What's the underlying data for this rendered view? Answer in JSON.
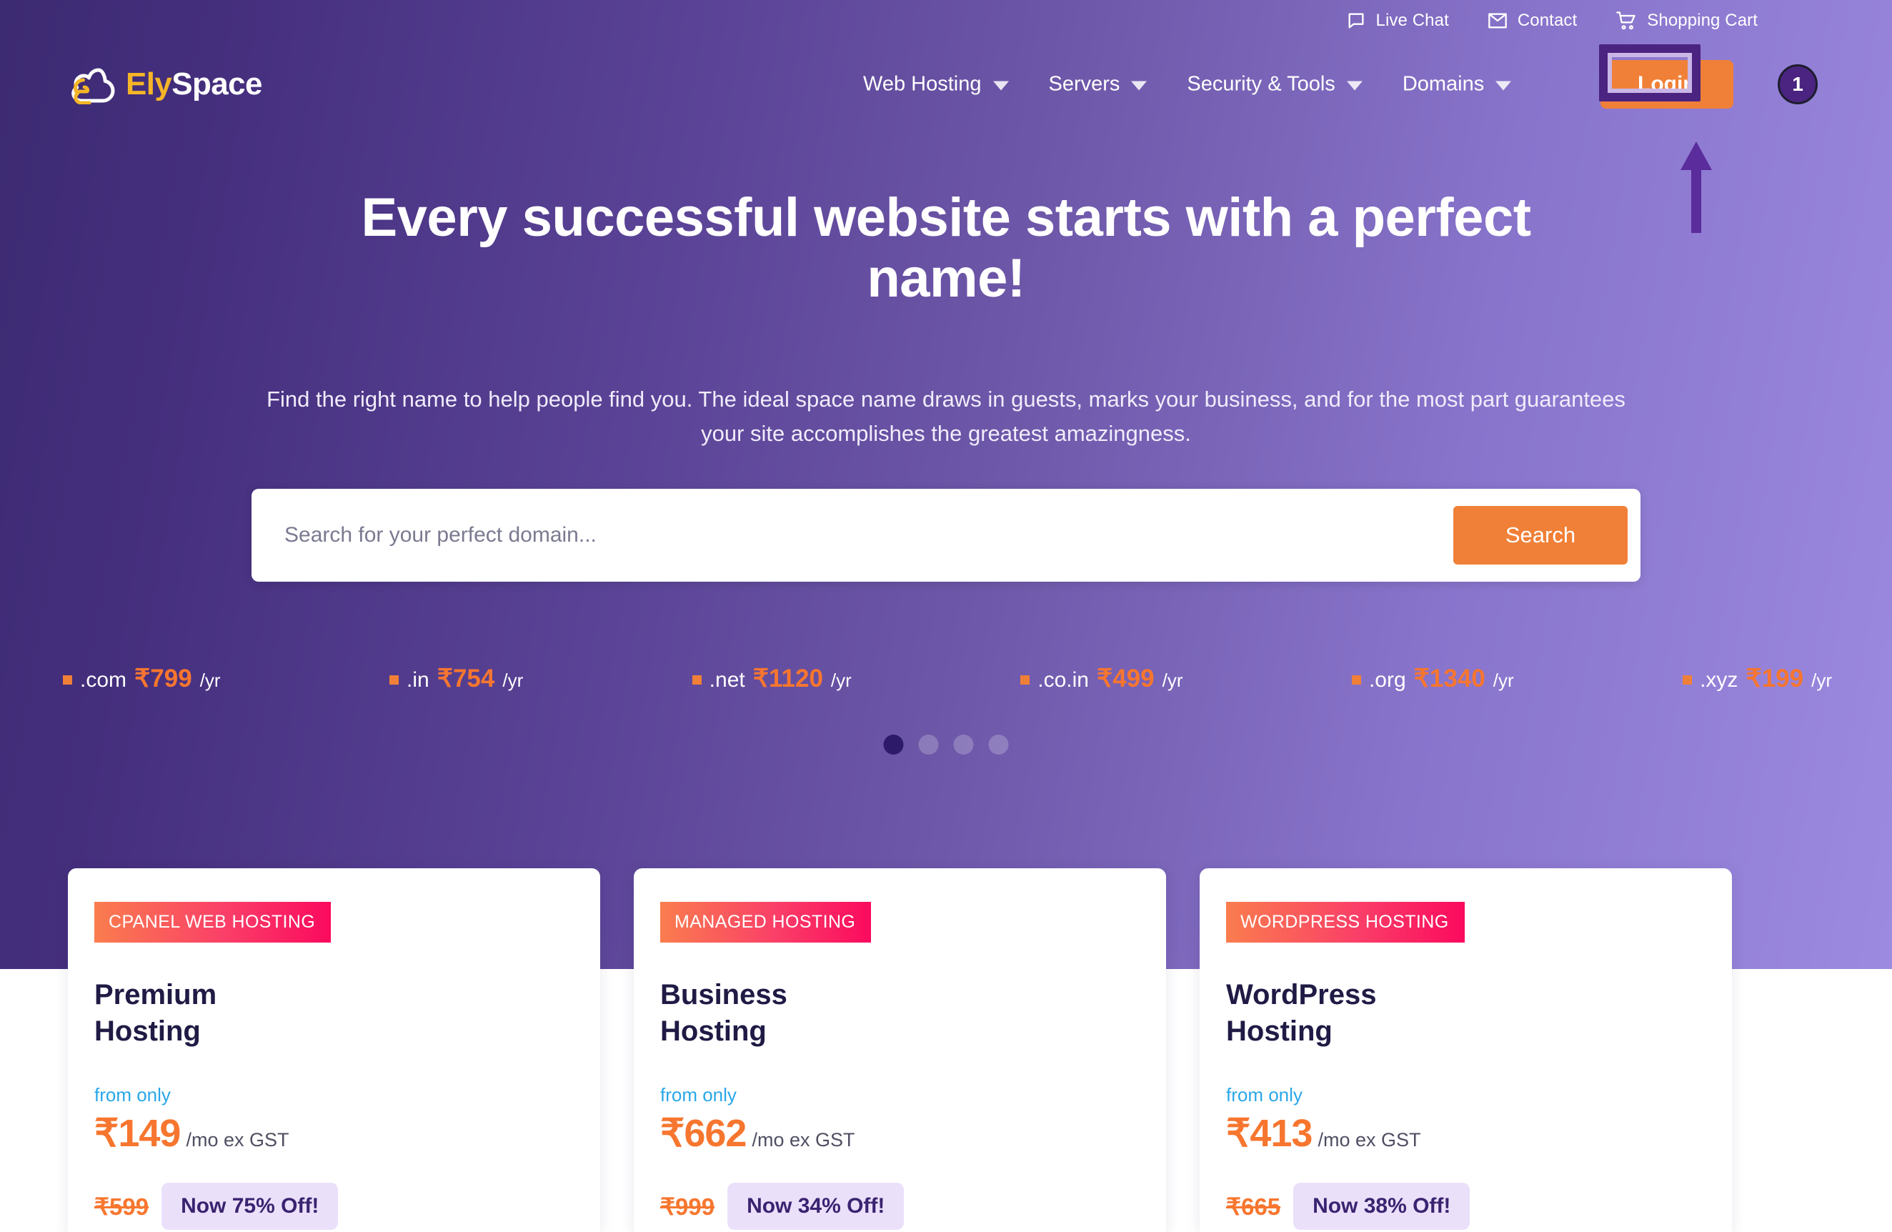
{
  "topbar": {
    "links": [
      {
        "label": "Live Chat",
        "icon": "chat-bubble-icon"
      },
      {
        "label": "Contact",
        "icon": "envelope-icon"
      },
      {
        "label": "Shopping Cart",
        "icon": "shopping-cart-icon"
      }
    ]
  },
  "brand": {
    "name_part1": "Ely",
    "name_part2": "Space",
    "color_part1": "#F5B528",
    "color_part2": "#FFFFFF",
    "logo_icon": "cloud-logo-icon"
  },
  "nav": {
    "items": [
      {
        "label": "Web Hosting",
        "has_dropdown": true
      },
      {
        "label": "Servers",
        "has_dropdown": true
      },
      {
        "label": "Security & Tools",
        "has_dropdown": true
      },
      {
        "label": "Domains",
        "has_dropdown": true
      }
    ],
    "login_label": "Login",
    "login_color": "#F08037"
  },
  "annotation": {
    "step_number": "1",
    "highlight_color": "#4B2481",
    "arrow_icon": "arrow-up-icon"
  },
  "hero": {
    "title": "Every successful website starts with a perfect name!",
    "subtitle": "Find the right name to help people find you. The ideal space name draws in guests, marks your business, and for the most part guarantees your site accomplishes the greatest amazingness."
  },
  "search": {
    "placeholder": "Search for your perfect domain...",
    "value": "",
    "button_label": "Search"
  },
  "tlds": [
    {
      "name": ".com",
      "price": "₹799",
      "per": "/yr"
    },
    {
      "name": ".in",
      "price": "₹754",
      "per": "/yr"
    },
    {
      "name": ".net",
      "price": "₹1120",
      "per": "/yr"
    },
    {
      "name": ".co.in",
      "price": "₹499",
      "per": "/yr"
    },
    {
      "name": ".org",
      "price": "₹1340",
      "per": "/yr"
    },
    {
      "name": ".xyz",
      "price": "₹199",
      "per": "/yr"
    }
  ],
  "carousel": {
    "total_dots": 4,
    "active_index": 0
  },
  "cards": [
    {
      "badge": "CPANEL WEB HOSTING",
      "title": "Premium Hosting",
      "from_label": "from only",
      "price": "₹149",
      "price_unit": "/mo ex GST",
      "old_price": "₹599",
      "offer": "Now 75% Off!"
    },
    {
      "badge": "MANAGED HOSTING",
      "title": "Business Hosting",
      "from_label": "from only",
      "price": "₹662",
      "price_unit": "/mo ex GST",
      "old_price": "₹999",
      "offer": "Now 34% Off!"
    },
    {
      "badge": "WORDPRESS HOSTING",
      "title": "WordPress Hosting",
      "from_label": "from only",
      "price": "₹413",
      "price_unit": "/mo ex GST",
      "old_price": "₹665",
      "offer": "Now 38% Off!"
    }
  ]
}
